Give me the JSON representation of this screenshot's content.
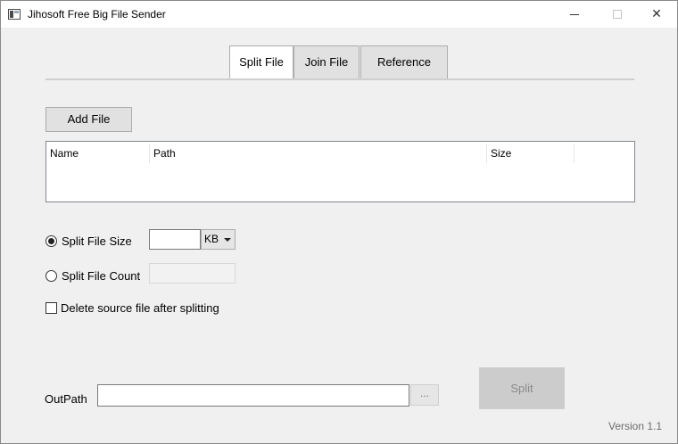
{
  "window": {
    "title": "Jihosoft Free Big File Sender",
    "controls": {
      "minimize": "minimize",
      "maximize": "maximize",
      "close": "✕"
    }
  },
  "tabs": [
    {
      "label": "Split File",
      "active": true
    },
    {
      "label": "Join File",
      "active": false
    },
    {
      "label": "Reference",
      "active": false
    }
  ],
  "split": {
    "add_file_label": "Add File",
    "file_list": {
      "columns": [
        "Name",
        "Path",
        "Size"
      ],
      "rows": []
    },
    "split_by_size": {
      "label": "Split File Size",
      "checked": true,
      "value": "",
      "unit": "KB"
    },
    "split_by_count": {
      "label": "Split File Count",
      "checked": false,
      "value": ""
    },
    "delete_source": {
      "label": "Delete source file after splitting",
      "checked": false
    },
    "outpath": {
      "label": "OutPath",
      "value": "",
      "browse_label": "..."
    },
    "split_button_label": "Split"
  },
  "version": "Version 1.1"
}
